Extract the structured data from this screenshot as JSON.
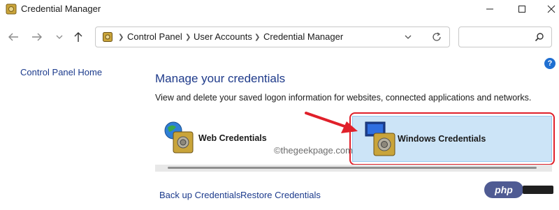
{
  "window": {
    "title": "Credential Manager"
  },
  "address_bar": {
    "crumbs": [
      "Control Panel",
      "User Accounts",
      "Credential Manager"
    ]
  },
  "search": {
    "placeholder": ""
  },
  "left_nav": {
    "home_link": "Control Panel Home"
  },
  "help": {
    "glyph": "?"
  },
  "main": {
    "title": "Manage your credentials",
    "description": "View and delete your saved logon information for websites, connected applications and networks.",
    "tiles": [
      {
        "label": "Web Credentials",
        "selected": false
      },
      {
        "label": "Windows Credentials",
        "selected": true
      }
    ],
    "watermark": "©thegeekpage.com",
    "links": [
      "Back up Credentials",
      "Restore Credentials"
    ]
  },
  "badge": {
    "text": "php"
  },
  "colors": {
    "link": "#1b3a8c",
    "title": "#1e3a8a",
    "selection": "#cce4f7",
    "annotation": "#e0202a"
  }
}
